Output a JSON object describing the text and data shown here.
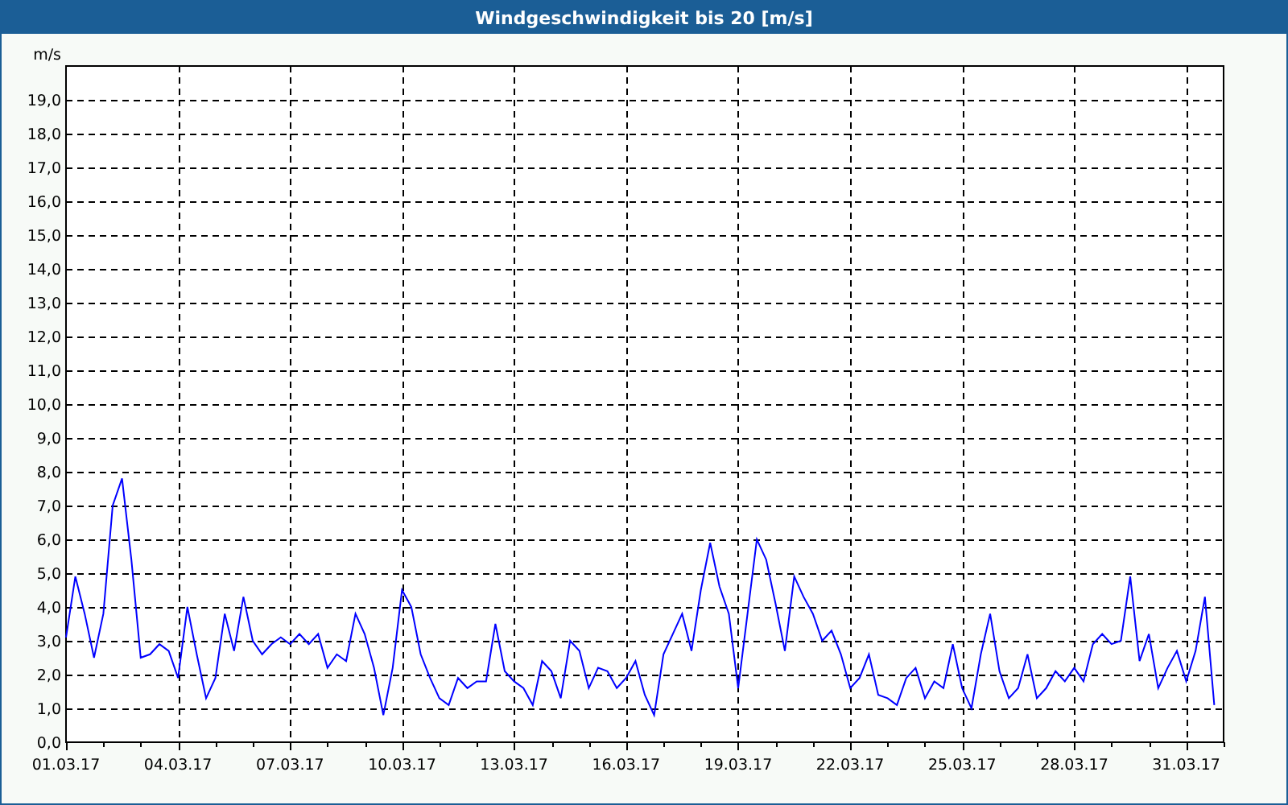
{
  "window": {
    "title": "Windgeschwindigkeit bis 20 [m/s]"
  },
  "chart": {
    "chart_data": {
      "type": "line",
      "grid": true,
      "ylabel": "m/s",
      "ylim": [
        0,
        20
      ],
      "yticks": [
        {
          "value": 0,
          "label": "0,0"
        },
        {
          "value": 1,
          "label": "1,0"
        },
        {
          "value": 2,
          "label": "2,0"
        },
        {
          "value": 3,
          "label": "3,0"
        },
        {
          "value": 4,
          "label": "4,0"
        },
        {
          "value": 5,
          "label": "5,0"
        },
        {
          "value": 6,
          "label": "6,0"
        },
        {
          "value": 7,
          "label": "7,0"
        },
        {
          "value": 8,
          "label": "8,0"
        },
        {
          "value": 9,
          "label": "9,0"
        },
        {
          "value": 10,
          "label": "10,0"
        },
        {
          "value": 11,
          "label": "11,0"
        },
        {
          "value": 12,
          "label": "12,0"
        },
        {
          "value": 13,
          "label": "13,0"
        },
        {
          "value": 14,
          "label": "14,0"
        },
        {
          "value": 15,
          "label": "15,0"
        },
        {
          "value": 16,
          "label": "16,0"
        },
        {
          "value": 17,
          "label": "17,0"
        },
        {
          "value": 18,
          "label": "18,0"
        },
        {
          "value": 19,
          "label": "19,0"
        }
      ],
      "categories": [
        "01.03.17",
        null,
        null,
        null,
        null,
        null,
        null,
        null,
        null,
        null,
        null,
        null,
        "04.03.17",
        null,
        null,
        null,
        null,
        null,
        null,
        null,
        null,
        null,
        null,
        null,
        "07.03.17",
        null,
        null,
        null,
        null,
        null,
        null,
        null,
        null,
        null,
        null,
        null,
        "10.03.17",
        null,
        null,
        null,
        null,
        null,
        null,
        null,
        null,
        null,
        null,
        null,
        "13.03.17",
        null,
        null,
        null,
        null,
        null,
        null,
        null,
        null,
        null,
        null,
        null,
        "16.03.17",
        null,
        null,
        null,
        null,
        null,
        null,
        null,
        null,
        null,
        null,
        null,
        "19.03.17",
        null,
        null,
        null,
        null,
        null,
        null,
        null,
        null,
        null,
        null,
        null,
        "22.03.17",
        null,
        null,
        null,
        null,
        null,
        null,
        null,
        null,
        null,
        null,
        null,
        "25.03.17",
        null,
        null,
        null,
        null,
        null,
        null,
        null,
        null,
        null,
        null,
        null,
        "28.03.17",
        null,
        null,
        null,
        null,
        null,
        null,
        null,
        null,
        null,
        null,
        null,
        "31.03.17",
        null,
        null,
        null
      ],
      "series": [
        {
          "color": "#0000ff",
          "values": [
            3.1,
            4.9,
            3.8,
            2.5,
            3.8,
            7.0,
            7.8,
            5.4,
            2.5,
            2.6,
            2.9,
            2.7,
            1.9,
            4.0,
            2.6,
            1.3,
            1.9,
            3.8,
            2.7,
            4.3,
            3.0,
            2.6,
            2.9,
            3.1,
            2.9,
            3.2,
            2.9,
            3.2,
            2.2,
            2.6,
            2.4,
            3.8,
            3.2,
            2.2,
            0.8,
            2.2,
            4.5,
            4.0,
            2.6,
            1.9,
            1.3,
            1.1,
            1.9,
            1.6,
            1.8,
            1.8,
            3.5,
            2.1,
            1.8,
            1.6,
            1.1,
            2.4,
            2.1,
            1.3,
            3.0,
            2.7,
            1.6,
            2.2,
            2.1,
            1.6,
            1.9,
            2.4,
            1.4,
            0.8,
            2.6,
            3.2,
            3.8,
            2.7,
            4.5,
            5.9,
            4.6,
            3.8,
            1.6,
            3.8,
            6.0,
            5.4,
            4.1,
            2.7,
            4.9,
            4.3,
            3.8,
            3.0,
            3.3,
            2.6,
            1.6,
            1.9,
            2.6,
            1.4,
            1.3,
            1.1,
            1.9,
            2.2,
            1.3,
            1.8,
            1.6,
            2.9,
            1.6,
            1.0,
            2.6,
            3.8,
            2.1,
            1.3,
            1.6,
            2.6,
            1.3,
            1.6,
            2.1,
            1.8,
            2.2,
            1.8,
            2.9,
            3.2,
            2.9,
            3.0,
            4.9,
            2.4,
            3.2,
            1.6,
            2.2,
            2.7,
            1.8,
            2.7,
            4.3,
            1.1
          ]
        }
      ]
    }
  }
}
